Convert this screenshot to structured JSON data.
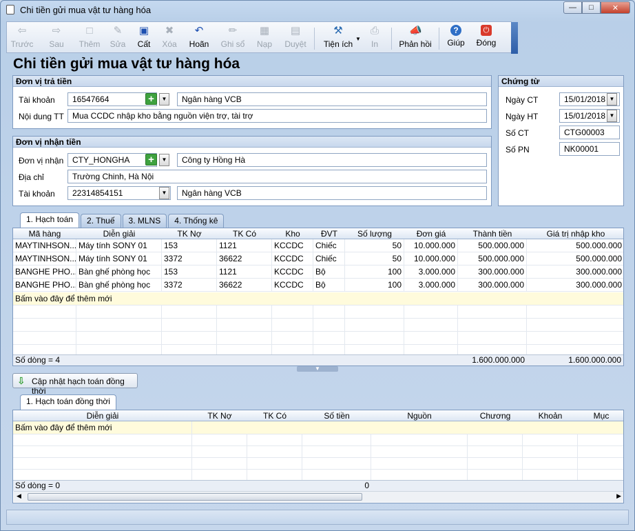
{
  "window": {
    "title": "Chi tiền gửi mua vật tư hàng hóa"
  },
  "toolbar": {
    "prev": "Trước",
    "next": "Sau",
    "add": "Thêm",
    "edit": "Sửa",
    "save": "Cất",
    "delete": "Xóa",
    "undo": "Hoãn",
    "post": "Ghi sổ",
    "load": "Nạp",
    "approve": "Duyệt",
    "utilities": "Tiện ích",
    "print": "In",
    "feedback": "Phản hồi",
    "help": "Giúp",
    "close": "Đóng"
  },
  "heading": "Chi tiền gửi mua vật tư hàng hóa",
  "payer": {
    "title": "Đơn vị trả tiền",
    "account_label": "Tài khoản",
    "account": "16547664",
    "bank": "Ngân hàng VCB",
    "content_label": "Nội dung TT",
    "content": "Mua CCDC nhập kho bằng nguồn viện trợ, tài trợ"
  },
  "receiver": {
    "title": "Đơn vị nhận tiền",
    "unit_label": "Đơn vị nhận",
    "unit": "CTY_HONGHA",
    "unit_name": "Công ty Hồng Hà",
    "address_label": "Địa chỉ",
    "address": "Trường Chinh, Hà Nội",
    "account_label": "Tài khoản",
    "account": "22314854151",
    "bank": "Ngân hàng VCB"
  },
  "voucher": {
    "title": "Chứng từ",
    "date_label": "Ngày CT",
    "date": "15/01/2018",
    "post_date_label": "Ngày HT",
    "post_date": "15/01/2018",
    "number_label": "Số CT",
    "number": "CTG00003",
    "pn_label": "Số PN",
    "pn": "NK00001"
  },
  "tabs": [
    "1. Hạch toán",
    "2. Thuế",
    "3. MLNS",
    "4. Thống kê"
  ],
  "grid1": {
    "columns": [
      "Mã hàng",
      "Diễn giải",
      "TK Nợ",
      "TK Có",
      "Kho",
      "ĐVT",
      "Số lượng",
      "Đơn giá",
      "Thành tiền",
      "Giá trị nhập kho"
    ],
    "rows": [
      [
        "MAYTINHSON...",
        "Máy tính SONY 01",
        "153",
        "1121",
        "KCCDC",
        "Chiếc",
        "50",
        "10.000.000",
        "500.000.000",
        "500.000.000"
      ],
      [
        "MAYTINHSON...",
        "Máy tính SONY 01",
        "3372",
        "36622",
        "KCCDC",
        "Chiếc",
        "50",
        "10.000.000",
        "500.000.000",
        "500.000.000"
      ],
      [
        "BANGHE PHO...",
        "Bàn ghế phòng học",
        "153",
        "1121",
        "KCCDC",
        "Bộ",
        "100",
        "3.000.000",
        "300.000.000",
        "300.000.000"
      ],
      [
        "BANGHE PHO...",
        "Bàn ghế phòng học",
        "3372",
        "36622",
        "KCCDC",
        "Bộ",
        "100",
        "3.000.000",
        "300.000.000",
        "300.000.000"
      ]
    ],
    "add_row": "Bấm vào đây để thêm mới",
    "footer_count": "Số dòng = 4",
    "footer_total": "1.600.000.000",
    "footer_total2": "1.600.000.000"
  },
  "update_button": "Cập nhật hạch toán đồng thời",
  "tabs2": [
    "1. Hạch toán đồng thời"
  ],
  "grid2": {
    "columns": [
      "Diễn giải",
      "TK Nợ",
      "TK Có",
      "Số tiền",
      "Nguồn",
      "Chương",
      "Khoản",
      "Mục"
    ],
    "add_row": "Bấm vào đây để thêm mới",
    "footer_count": "Số dòng = 0",
    "footer_total": "0"
  }
}
